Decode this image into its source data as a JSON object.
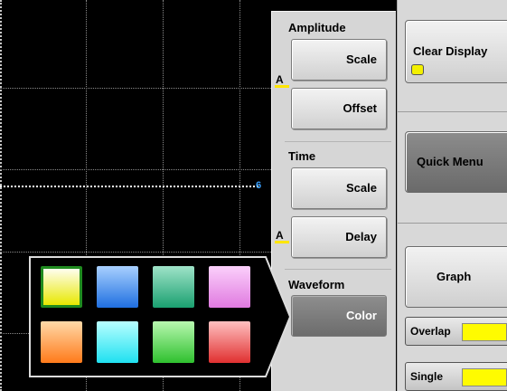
{
  "scope": {
    "channel_marker": "6",
    "trace_color": "#ffffff",
    "channel_color": "#3aa0ff"
  },
  "menu": {
    "amplitude": {
      "label": "Amplitude",
      "scale": "Scale",
      "offset": "Offset",
      "link_marker": "A"
    },
    "time": {
      "label": "Time",
      "scale": "Scale",
      "delay": "Delay",
      "link_marker": "A"
    },
    "waveform": {
      "label": "Waveform",
      "color": "Color"
    }
  },
  "right_panel": {
    "clear_display": "Clear Display",
    "quick_menu": "Quick Menu",
    "graph": "Graph",
    "overlap": "Overlap",
    "single": "Single"
  },
  "color_picker": {
    "selected_index": 0,
    "swatches": [
      {
        "name": "yellow",
        "top": "#fffef0",
        "bottom": "#e8e800"
      },
      {
        "name": "blue",
        "top": "#a8d0ff",
        "bottom": "#1f6fe0"
      },
      {
        "name": "teal-green",
        "top": "#9fe3c8",
        "bottom": "#1aa070"
      },
      {
        "name": "pink",
        "top": "#fbd0fb",
        "bottom": "#e07ae0"
      },
      {
        "name": "orange",
        "top": "#ffd9a8",
        "bottom": "#ff7a1a"
      },
      {
        "name": "cyan",
        "top": "#b8ffff",
        "bottom": "#1fe0f0"
      },
      {
        "name": "green",
        "top": "#b8f8b0",
        "bottom": "#2ec02e"
      },
      {
        "name": "red",
        "top": "#ffc0c0",
        "bottom": "#e03030"
      }
    ]
  }
}
